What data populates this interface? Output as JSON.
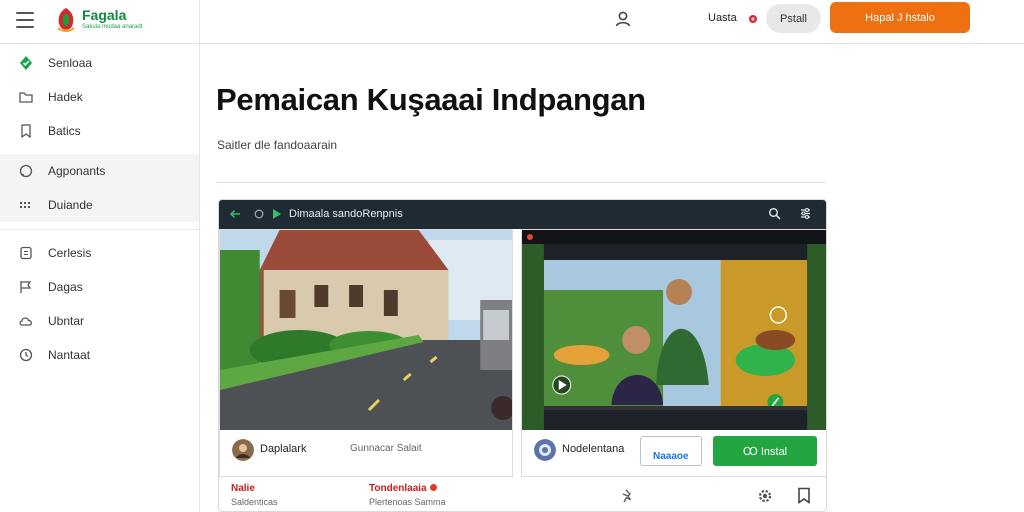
{
  "header": {
    "brand_name": "Fagala",
    "brand_tagline": "Sakula mudaa anaradt",
    "lang_label": "Uasta",
    "secondary_button": "Pstall",
    "primary_button": "Hapal J hstalo",
    "brand_color": "#0d8a3c",
    "accent_color": "#ee7011",
    "user_icon": "user-icon",
    "lang_flag_icon": "flower-icon"
  },
  "sidebar": {
    "items": [
      {
        "label": "Senloaa",
        "icon": "check-badge-icon"
      },
      {
        "label": "Hadek",
        "icon": "folder-icon"
      },
      {
        "label": "Batics",
        "icon": "bookmark-icon"
      },
      {
        "label": "Agponants",
        "icon": "chat-icon"
      },
      {
        "label": "Duiande",
        "icon": "grid-icon"
      },
      {
        "label": "Cerlesis",
        "icon": "document-icon"
      },
      {
        "label": "Dagas",
        "icon": "flag-icon"
      },
      {
        "label": "Ubntar",
        "icon": "cloud-icon"
      },
      {
        "label": "Nantaat",
        "icon": "clock-icon"
      }
    ]
  },
  "main": {
    "title": "Pemaican Kuşaaai Indpangan",
    "subtitle": "Saitler dle fandoaarain"
  },
  "panel": {
    "bar_text": "Dimaala sandoRenpnis",
    "bar_color": "#1f2a33",
    "cards": [
      {
        "name": "Daplalark",
        "meta": "Gunnacar Salait"
      },
      {
        "name": "Nodelentana",
        "field_value": "Naaaoe",
        "install_label": "Ꝏ Instal",
        "install_color": "#23a642"
      }
    ],
    "bottom": {
      "title1": "Nalie",
      "sub1": "Saldenticas",
      "title2": "Tondenlaaia",
      "sub2": "Plertenoas Samma"
    }
  }
}
